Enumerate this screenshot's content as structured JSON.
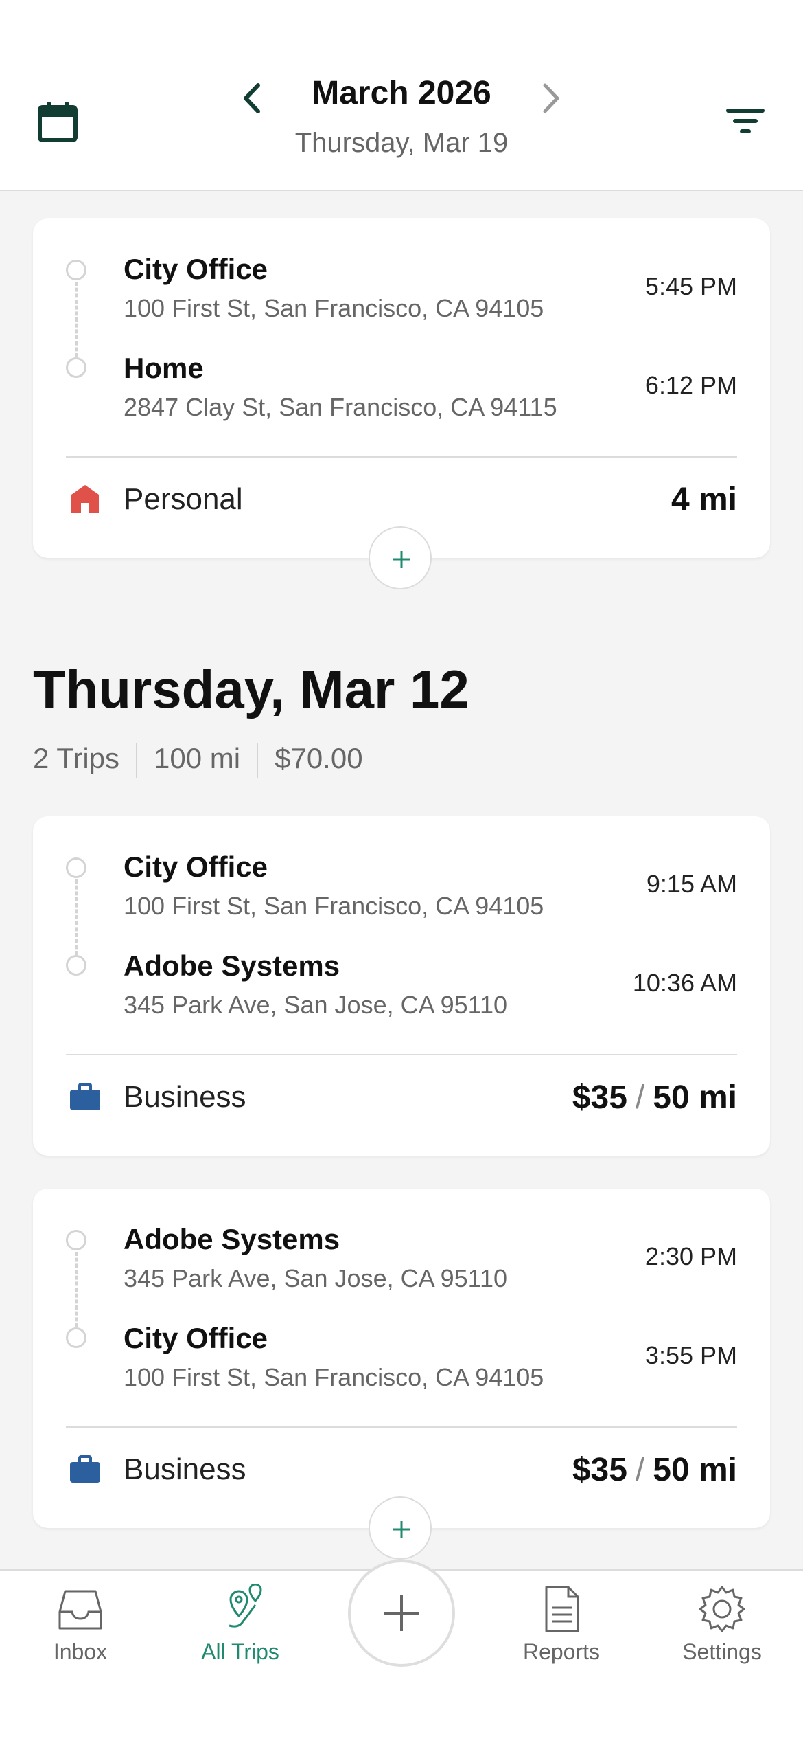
{
  "header": {
    "month_title": "March 2026",
    "day_subtitle": "Thursday, Mar 19"
  },
  "trip_mar19": {
    "start": {
      "name": "City Office",
      "address": "100 First St, San Francisco, CA 94105",
      "time": "5:45 PM"
    },
    "end": {
      "name": "Home",
      "address": "2847 Clay St, San Francisco, CA 94115",
      "time": "6:12 PM"
    },
    "category": "Personal",
    "category_icon": "home-icon",
    "distance": "4 mi"
  },
  "day_mar12": {
    "title": "Thursday, Mar 12",
    "trips_count": "2 Trips",
    "total_distance": "100 mi",
    "total_amount": "$70.00"
  },
  "trip_mar12_a": {
    "start": {
      "name": "City Office",
      "address": "100 First St, San Francisco, CA 94105",
      "time": "9:15 AM"
    },
    "end": {
      "name": "Adobe Systems",
      "address": "345 Park Ave, San Jose, CA 95110",
      "time": "10:36 AM"
    },
    "category": "Business",
    "category_icon": "briefcase-icon",
    "amount": "$35",
    "distance": "50 mi"
  },
  "trip_mar12_b": {
    "start": {
      "name": "Adobe Systems",
      "address": "345 Park Ave, San Jose, CA 95110",
      "time": "2:30 PM"
    },
    "end": {
      "name": "City Office",
      "address": "100 First St, San Francisco, CA 94105",
      "time": "3:55 PM"
    },
    "category": "Business",
    "category_icon": "briefcase-icon",
    "amount": "$35",
    "distance": "50 mi"
  },
  "tabs": {
    "inbox": "Inbox",
    "all_trips": "All Trips",
    "reports": "Reports",
    "settings": "Settings"
  },
  "colors": {
    "accent": "#1f8a6f",
    "personal": "#e0514a",
    "business": "#2b5f9e",
    "header_icon": "#123d33"
  }
}
